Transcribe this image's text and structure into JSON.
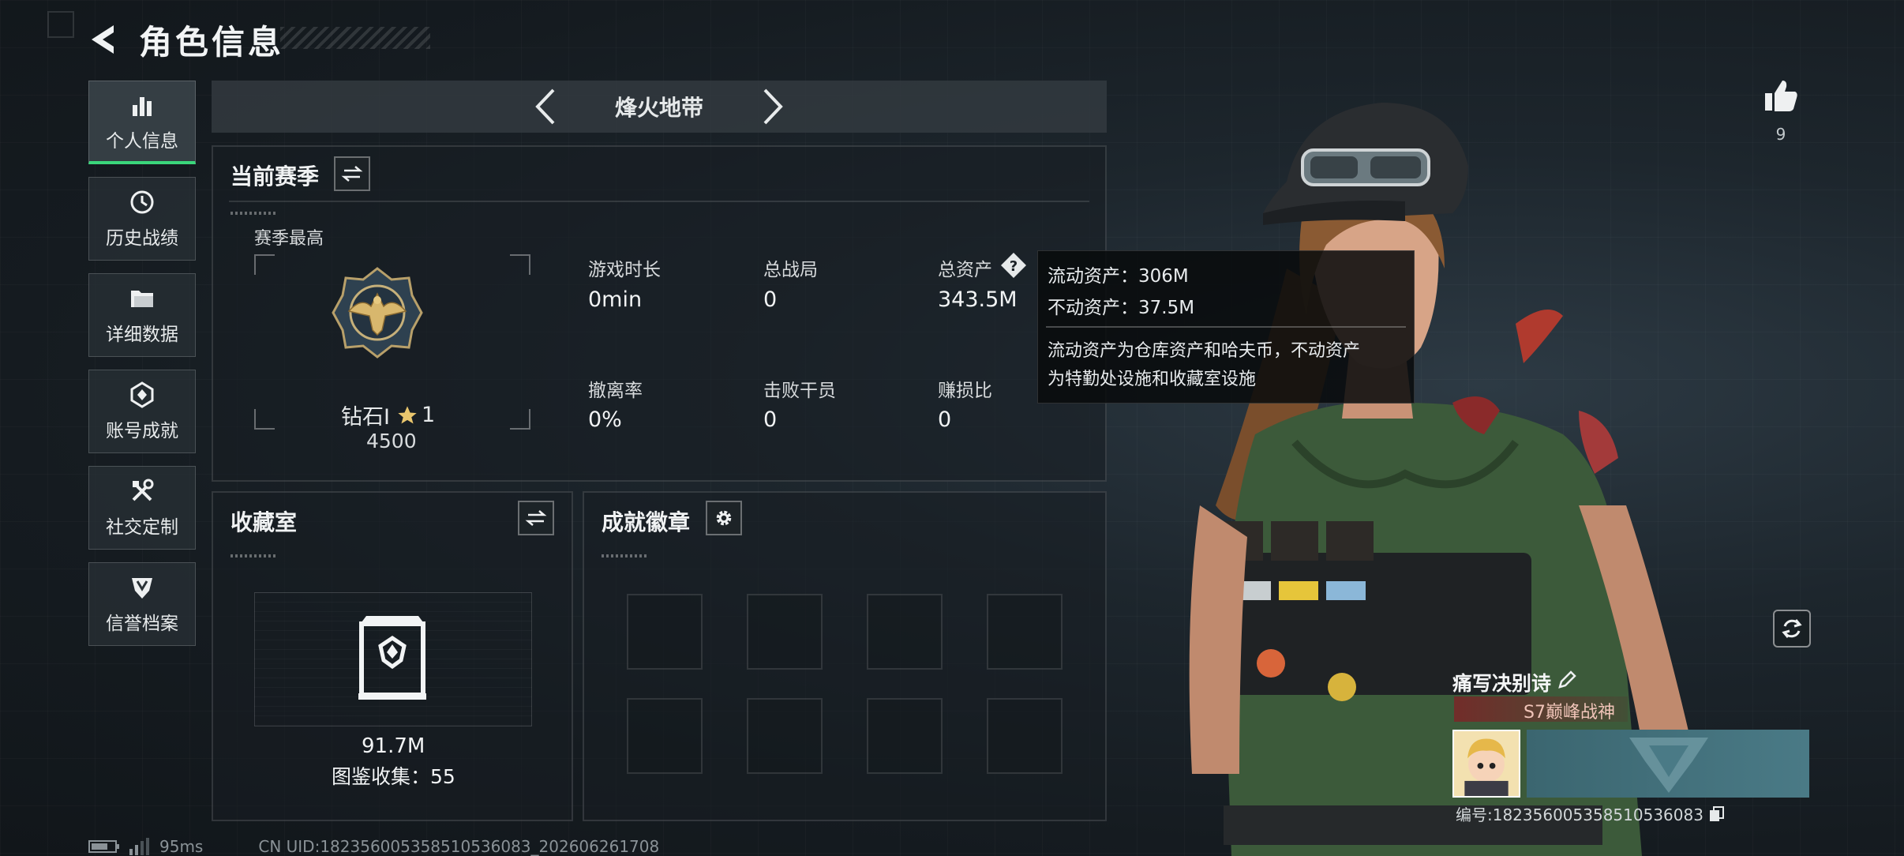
{
  "header": {
    "title": "角色信息"
  },
  "sidebar": {
    "items": [
      {
        "label": "个人信息",
        "icon": "bar-chart-icon",
        "active": true
      },
      {
        "label": "历史战绩",
        "icon": "history-icon"
      },
      {
        "label": "详细数据",
        "icon": "folder-icon"
      },
      {
        "label": "账号成就",
        "icon": "achievement-icon"
      },
      {
        "label": "社交定制",
        "icon": "tools-icon"
      },
      {
        "label": "信誉档案",
        "icon": "shield-icon"
      }
    ]
  },
  "mode": {
    "title": "烽火地带"
  },
  "season": {
    "title": "当前赛季",
    "best_label": "赛季最高",
    "rank_name": "钻石Ⅰ",
    "rank_stars": "1",
    "rank_score": "4500",
    "stats": [
      {
        "label": "游戏时长",
        "value": "0min"
      },
      {
        "label": "总战局",
        "value": "0"
      },
      {
        "label": "总资产",
        "value": "343.5M"
      },
      {
        "label": "撤离率",
        "value": "0%"
      },
      {
        "label": "击败干员",
        "value": "0"
      },
      {
        "label": "赚损比",
        "value": "0"
      }
    ]
  },
  "tooltip": {
    "line1": "流动资产：306M",
    "line2": "不动资产：37.5M",
    "desc1": "流动资产为仓库资产和哈夫币，不动资产",
    "desc2": "为特勤处设施和收藏室设施"
  },
  "collection": {
    "title": "收藏室",
    "value": "91.7M",
    "count_label": "图鉴收集：55"
  },
  "badges": {
    "title": "成就徽章"
  },
  "like": {
    "count": "9"
  },
  "player": {
    "name": "痛写决别诗",
    "title": "S7巅峰战神",
    "uid": "编号:182356005358510536083"
  },
  "status": {
    "ping": "95ms",
    "cn_uid": "CN UID:182356005358510536083_202606261708"
  },
  "colors": {
    "accent": "#3ad67b"
  }
}
